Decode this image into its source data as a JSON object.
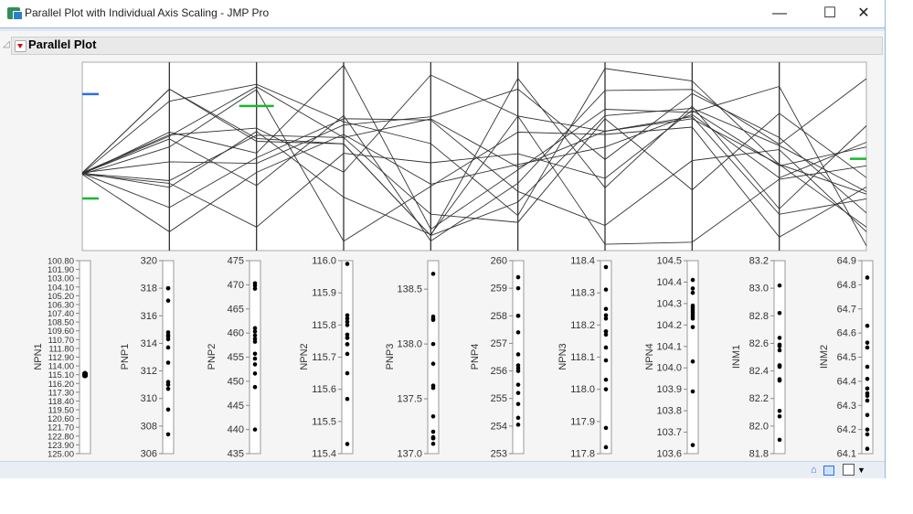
{
  "window": {
    "title": "Parallel Plot with Individual Axis Scaling - JMP Pro",
    "minimize": "—",
    "maximize": "☐",
    "close": "✕"
  },
  "outline": {
    "title": "Parallel Plot"
  },
  "colors": {
    "line": "#333333",
    "spec_blue": "#2b6fe8",
    "spec_green": "#19b82b"
  },
  "chart_data": {
    "type": "parallel",
    "axes": [
      {
        "name": "NPN1",
        "min": 100.8,
        "max": 125.0,
        "reversed": true,
        "ticks": [
          "100.80",
          "101.90",
          "103.00",
          "104.10",
          "105.20",
          "106.30",
          "107.40",
          "108.50",
          "109.60",
          "110.70",
          "111.80",
          "112.90",
          "114.00",
          "115.10",
          "116.20",
          "117.30",
          "118.40",
          "119.50",
          "120.60",
          "121.70",
          "122.80",
          "123.90",
          "125.00"
        ]
      },
      {
        "name": "PNP1",
        "min": 306,
        "max": 320,
        "ticks": [
          "306",
          "308",
          "310",
          "312",
          "314",
          "316",
          "318",
          "320"
        ]
      },
      {
        "name": "PNP2",
        "min": 435,
        "max": 475,
        "ticks": [
          "435",
          "440",
          "445",
          "450",
          "455",
          "460",
          "465",
          "470",
          "475"
        ]
      },
      {
        "name": "NPN2",
        "min": 115.4,
        "max": 116.0,
        "ticks": [
          "115.4",
          "115.5",
          "115.6",
          "115.7",
          "115.8",
          "115.9",
          "116.0"
        ]
      },
      {
        "name": "PNP3",
        "min": 137.0,
        "max": 138.76,
        "ticks": [
          "137.0",
          "137.5",
          "138.0",
          "138.5"
        ]
      },
      {
        "name": "PNP4",
        "min": 253,
        "max": 260,
        "ticks": [
          "253",
          "254",
          "255",
          "256",
          "257",
          "258",
          "259",
          "260"
        ]
      },
      {
        "name": "NPN3",
        "min": 117.8,
        "max": 118.4,
        "ticks": [
          "117.8",
          "117.9",
          "118.0",
          "118.1",
          "118.2",
          "118.3",
          "118.4"
        ]
      },
      {
        "name": "NPN4",
        "min": 103.6,
        "max": 104.5,
        "ticks": [
          "103.6",
          "103.7",
          "103.8",
          "103.9",
          "104.0",
          "104.1",
          "104.2",
          "104.3",
          "104.4",
          "104.5"
        ]
      },
      {
        "name": "INM1",
        "min": 81.8,
        "max": 83.2,
        "ticks": [
          "81.8",
          "82.0",
          "82.2",
          "82.4",
          "82.6",
          "82.8",
          "83.0",
          "83.2"
        ]
      },
      {
        "name": "INM2",
        "min": 64.1,
        "max": 64.9,
        "ticks": [
          "64.1",
          "64.2",
          "64.3",
          "64.4",
          "64.5",
          "64.6",
          "64.7",
          "64.8",
          "64.9"
        ]
      }
    ],
    "rows": [
      [
        115.0,
        318.0,
        458.8,
        115.74,
        137.14,
        259.4,
        118.0,
        104.29,
        82.11,
        64.63
      ],
      [
        115.1,
        317.1,
        470.3,
        115.81,
        138.0,
        254.3,
        118.38,
        104.41,
        82.44,
        64.2
      ],
      [
        115.2,
        314.8,
        455.7,
        115.99,
        137.2,
        256.0,
        118.25,
        104.26,
        83.02,
        64.12
      ],
      [
        115.0,
        314.6,
        461.0,
        115.65,
        138.64,
        258.0,
        117.82,
        103.64,
        82.33,
        64.46
      ],
      [
        115.1,
        314.3,
        448.8,
        115.83,
        137.09,
        255.5,
        118.31,
        104.37,
        82.59,
        64.83
      ],
      [
        115.2,
        313.7,
        469.2,
        115.43,
        137.6,
        257.4,
        118.17,
        104.19,
        81.9,
        64.37
      ],
      [
        115.0,
        312.6,
        453.5,
        115.8,
        138.25,
        259.0,
        118.09,
        104.35,
        82.64,
        64.26
      ],
      [
        115.1,
        311.2,
        459.5,
        115.76,
        137.34,
        254.05,
        118.22,
        103.89,
        82.82,
        64.41
      ],
      [
        115.2,
        311.0,
        440.0,
        115.71,
        137.82,
        256.6,
        118.03,
        104.27,
        82.43,
        64.54
      ],
      [
        115.0,
        310.7,
        460.3,
        115.57,
        137.15,
        258.0,
        118.18,
        104.24,
        82.07,
        64.32
      ],
      [
        115.1,
        309.2,
        454.7,
        115.82,
        138.22,
        255.2,
        117.88,
        104.03,
        82.55,
        64.18
      ],
      [
        115.2,
        307.4,
        451.6,
        115.77,
        137.62,
        256.2,
        118.13,
        104.25,
        82.34,
        64.56
      ],
      [
        115.0,
        318.0,
        458.2,
        115.74,
        137.14,
        254.8,
        118.23,
        104.28,
        82.58,
        64.35
      ],
      [
        115.1,
        314.5,
        469.8,
        115.76,
        138.23,
        256.1,
        118.18,
        104.23,
        82.44,
        64.34
      ]
    ],
    "spec_limits": [
      {
        "axis": 0,
        "value": 104.9,
        "color": "blue",
        "side": "right"
      },
      {
        "axis": 0,
        "value": 118.3,
        "color": "green",
        "side": "right"
      },
      {
        "axis": 2,
        "value": 465.7,
        "color": "green",
        "side": "center"
      },
      {
        "axis": 9,
        "value": 64.49,
        "color": "green",
        "side": "left"
      }
    ]
  }
}
